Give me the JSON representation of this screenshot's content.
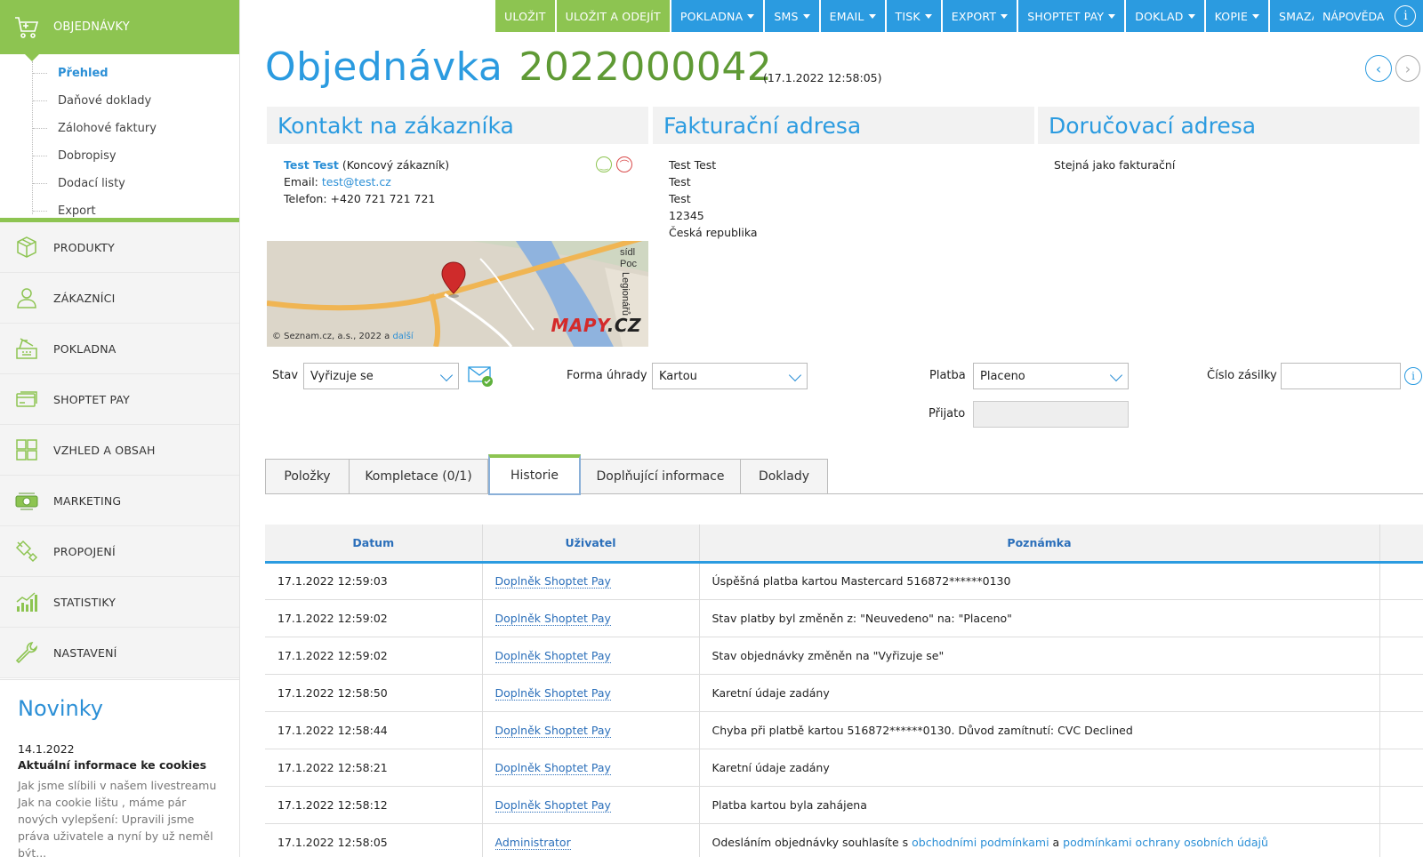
{
  "toolbar": {
    "buttons": [
      {
        "label": "ULOŽIT",
        "style": "green",
        "caret": false
      },
      {
        "label": "ULOŽIT A ODEJÍT",
        "style": "green",
        "caret": false
      },
      {
        "label": "POKLADNA",
        "style": "blue",
        "caret": true
      },
      {
        "label": "SMS",
        "style": "blue",
        "caret": true
      },
      {
        "label": "EMAIL",
        "style": "blue",
        "caret": true
      },
      {
        "label": "TISK",
        "style": "blue",
        "caret": true
      },
      {
        "label": "EXPORT",
        "style": "blue",
        "caret": true
      },
      {
        "label": "SHOPTET PAY",
        "style": "blue",
        "caret": true
      },
      {
        "label": "DOKLAD",
        "style": "blue",
        "caret": true
      },
      {
        "label": "KOPIE",
        "style": "blue",
        "caret": true
      },
      {
        "label": "SMAZAT",
        "style": "blue",
        "caret": false
      }
    ],
    "help_label": "NÁPOVĚDA"
  },
  "sidebar": {
    "active_section": {
      "label": "OBJEDNÁVKY",
      "icon": "cart-icon"
    },
    "subitems": [
      {
        "label": "Přehled",
        "active": true
      },
      {
        "label": "Daňové doklady",
        "active": false
      },
      {
        "label": "Zálohové faktury",
        "active": false
      },
      {
        "label": "Dobropisy",
        "active": false
      },
      {
        "label": "Dodací listy",
        "active": false
      },
      {
        "label": "Export",
        "active": false
      }
    ],
    "items": [
      {
        "label": "PRODUKTY",
        "icon": "box-icon"
      },
      {
        "label": "ZÁKAZNÍCI",
        "icon": "user-icon"
      },
      {
        "label": "POKLADNA",
        "icon": "cash-register-icon"
      },
      {
        "label": "SHOPTET PAY",
        "icon": "card-icon"
      },
      {
        "label": "VZHLED A OBSAH",
        "icon": "layout-icon"
      },
      {
        "label": "MARKETING",
        "icon": "marketing-icon"
      },
      {
        "label": "PROPOJENÍ",
        "icon": "plug-icon"
      },
      {
        "label": "STATISTIKY",
        "icon": "chart-icon"
      },
      {
        "label": "NASTAVENÍ",
        "icon": "wrench-icon"
      }
    ],
    "news": {
      "heading": "Novinky",
      "date": "14.1.2022",
      "title": "Aktuální informace ke cookies",
      "text": "Jak jsme slíbili v našem  livestreamu Jak na cookie lištu , máme pár nových vylepšení: Upravili jsme práva uživatele a nyní by už neměl být..."
    }
  },
  "header": {
    "title": "Objednávka",
    "order_number": "2022000042",
    "date": "(17.1.2022 12:58:05)"
  },
  "contact": {
    "heading": "Kontakt na zákazníka",
    "name": "Test Test",
    "customer_type": "(Koncový zákazník)",
    "email_label": "Email: ",
    "email": "test@test.cz",
    "phone_label": "Telefon: ",
    "phone": "+420 721 721 721"
  },
  "billing": {
    "heading": "Fakturační adresa",
    "lines": [
      "Test Test",
      "Test",
      "Test",
      "12345",
      "Česká republika"
    ]
  },
  "delivery": {
    "heading": "Doručovací adresa",
    "text": "Stejná jako fakturační"
  },
  "map": {
    "copyright": "© Seznam.cz, a.s., ",
    "year": "2022",
    "and": " a ",
    "more": "další",
    "logo_a": "MAPY",
    "logo_b": ".CZ",
    "street": "Legionářů",
    "label1": "sídl",
    "label2": "Poc"
  },
  "form": {
    "stav_label": "Stav",
    "stav_value": "Vyřizuje se",
    "forma_label": "Forma úhrady",
    "forma_value": "Kartou",
    "platba_label": "Platba",
    "platba_value": "Placeno",
    "prijato_label": "Přijato",
    "prijato_value": "",
    "zasilka_label": "Číslo zásilky",
    "zasilka_value": ""
  },
  "tabs": [
    {
      "label": "Položky",
      "active": false
    },
    {
      "label": "Kompletace (0/1)",
      "active": false
    },
    {
      "label": "Historie",
      "active": true
    },
    {
      "label": "Doplňující informace",
      "active": false
    },
    {
      "label": "Doklady",
      "active": false
    }
  ],
  "history": {
    "columns": [
      "Datum",
      "Uživatel",
      "Poznámka"
    ],
    "rows": [
      {
        "date": "17.1.2022 12:59:03",
        "user": "Doplněk Shoptet Pay",
        "note": "Úspěšná platba kartou Mastercard 516872******0130"
      },
      {
        "date": "17.1.2022 12:59:02",
        "user": "Doplněk Shoptet Pay",
        "note": "Stav platby byl změněn z: \"Neuvedeno\" na: \"Placeno\""
      },
      {
        "date": "17.1.2022 12:59:02",
        "user": "Doplněk Shoptet Pay",
        "note": "Stav objednávky změněn na \"Vyřizuje se\""
      },
      {
        "date": "17.1.2022 12:58:50",
        "user": "Doplněk Shoptet Pay",
        "note": "Karetní údaje zadány"
      },
      {
        "date": "17.1.2022 12:58:44",
        "user": "Doplněk Shoptet Pay",
        "note": "Chyba při platbě kartou 516872******0130. Důvod zamítnutí: CVC Declined"
      },
      {
        "date": "17.1.2022 12:58:21",
        "user": "Doplněk Shoptet Pay",
        "note": "Karetní údaje zadány"
      },
      {
        "date": "17.1.2022 12:58:12",
        "user": "Doplněk Shoptet Pay",
        "note": "Platba kartou byla zahájena"
      }
    ],
    "last_row": {
      "date": "17.1.2022 12:58:05",
      "user": "Administrator",
      "note_prefix": "Odesláním objednávky souhlasíte s ",
      "link1": "obchodními podmínkami",
      "note_mid": " a ",
      "link2": "podmínkami ochrany osobních údajů"
    }
  },
  "colors": {
    "green": "#8dc451",
    "blue": "#2b9be0",
    "order_number": "#5f9a35"
  }
}
